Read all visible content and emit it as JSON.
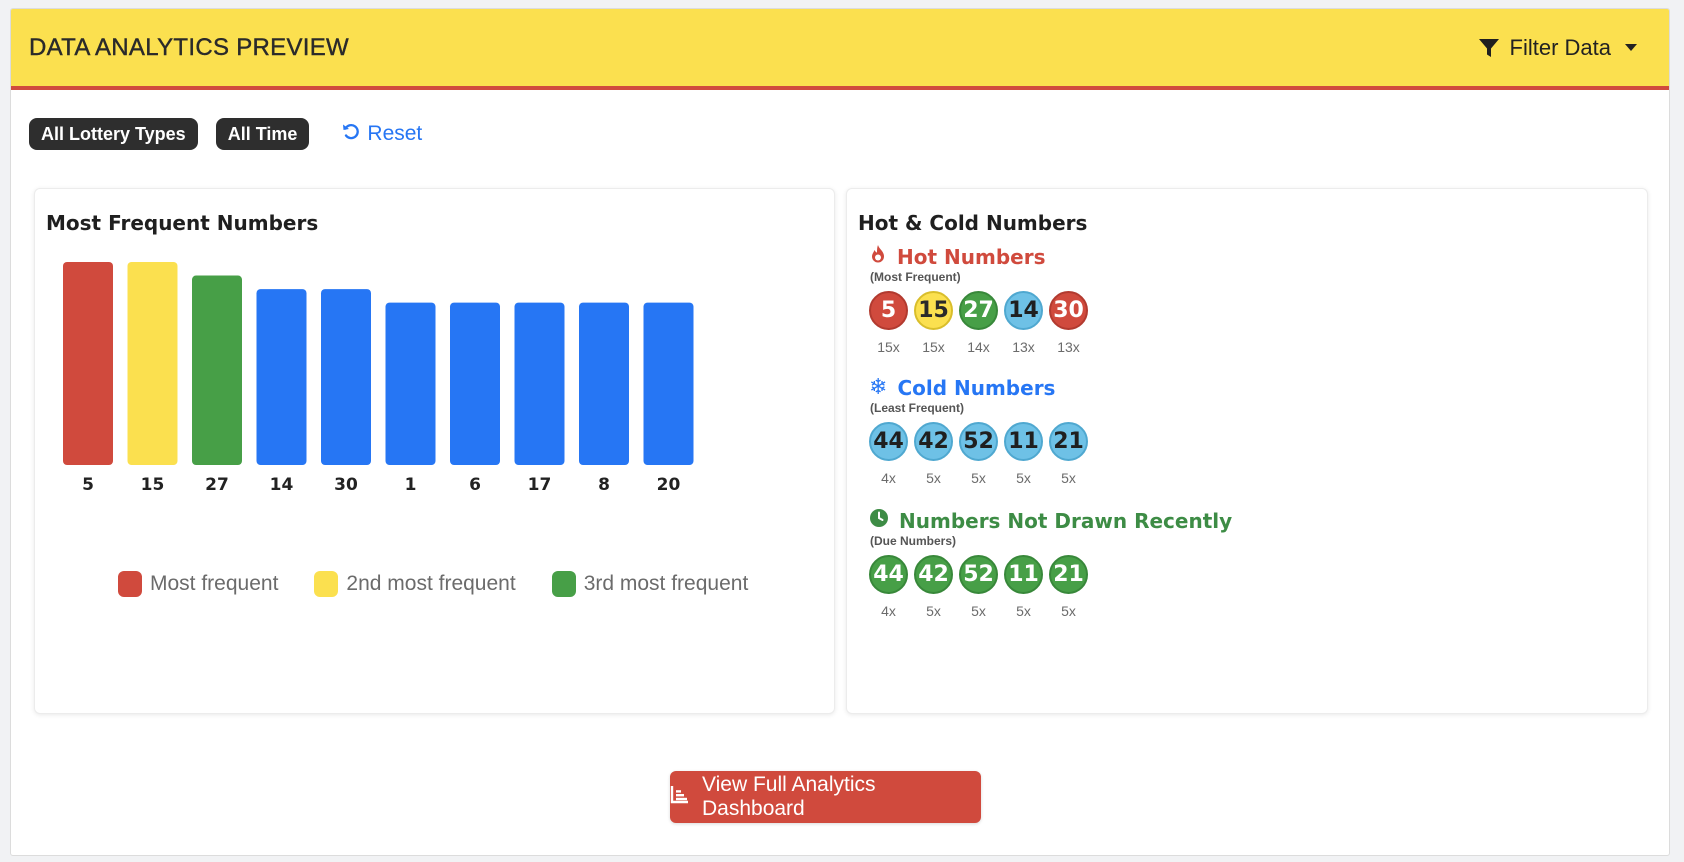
{
  "header": {
    "title": "DATA ANALYTICS PREVIEW",
    "filter_label": "Filter Data"
  },
  "filters": {
    "badges": [
      "All Lottery Types",
      "All Time"
    ],
    "reset_label": "Reset"
  },
  "frequent_panel": {
    "title": "Most Frequent Numbers",
    "legend": [
      {
        "label": "Most frequent",
        "color": "#d04a3d"
      },
      {
        "label": "2nd most frequent",
        "color": "#fbe04f"
      },
      {
        "label": "3rd most frequent",
        "color": "#479f47"
      }
    ]
  },
  "chart_data": {
    "type": "bar",
    "title": "Most Frequent Numbers",
    "categories": [
      "5",
      "15",
      "27",
      "14",
      "30",
      "1",
      "6",
      "17",
      "8",
      "20"
    ],
    "values": [
      15,
      15,
      14,
      13,
      13,
      12,
      12,
      12,
      12,
      12
    ],
    "colors": [
      "#d04a3d",
      "#fbe04f",
      "#479f47",
      "#2676f4",
      "#2676f4",
      "#2676f4",
      "#2676f4",
      "#2676f4",
      "#2676f4",
      "#2676f4"
    ],
    "ylim": [
      0,
      15
    ],
    "grid": false,
    "legend_position": "bottom"
  },
  "hot_cold_panel": {
    "title": "Hot & Cold Numbers",
    "sections": [
      {
        "title": "Hot Numbers",
        "subtitle": "(Most Frequent)",
        "icon": "fire-icon",
        "color": "#d04a3d",
        "balls": [
          {
            "number": "5",
            "count": "15x",
            "style": "red"
          },
          {
            "number": "15",
            "count": "15x",
            "style": "yellow"
          },
          {
            "number": "27",
            "count": "14x",
            "style": "green"
          },
          {
            "number": "14",
            "count": "13x",
            "style": "blue"
          },
          {
            "number": "30",
            "count": "13x",
            "style": "red"
          }
        ]
      },
      {
        "title": "Cold Numbers",
        "subtitle": "(Least Frequent)",
        "icon": "snowflake-icon",
        "color": "#2676f4",
        "balls": [
          {
            "number": "44",
            "count": "4x",
            "style": "blue"
          },
          {
            "number": "42",
            "count": "5x",
            "style": "blue"
          },
          {
            "number": "52",
            "count": "5x",
            "style": "blue"
          },
          {
            "number": "11",
            "count": "5x",
            "style": "blue"
          },
          {
            "number": "21",
            "count": "5x",
            "style": "blue"
          }
        ]
      },
      {
        "title": "Numbers Not Drawn Recently",
        "subtitle": "(Due Numbers)",
        "icon": "clock-icon",
        "color": "#3d8c45",
        "balls": [
          {
            "number": "44",
            "count": "4x",
            "style": "green"
          },
          {
            "number": "42",
            "count": "5x",
            "style": "green"
          },
          {
            "number": "52",
            "count": "5x",
            "style": "green"
          },
          {
            "number": "11",
            "count": "5x",
            "style": "green"
          },
          {
            "number": "21",
            "count": "5x",
            "style": "green"
          }
        ]
      }
    ]
  },
  "cta": {
    "label": "View Full Analytics Dashboard",
    "icon": "chart-area-icon",
    "color": "#d04a3d"
  }
}
